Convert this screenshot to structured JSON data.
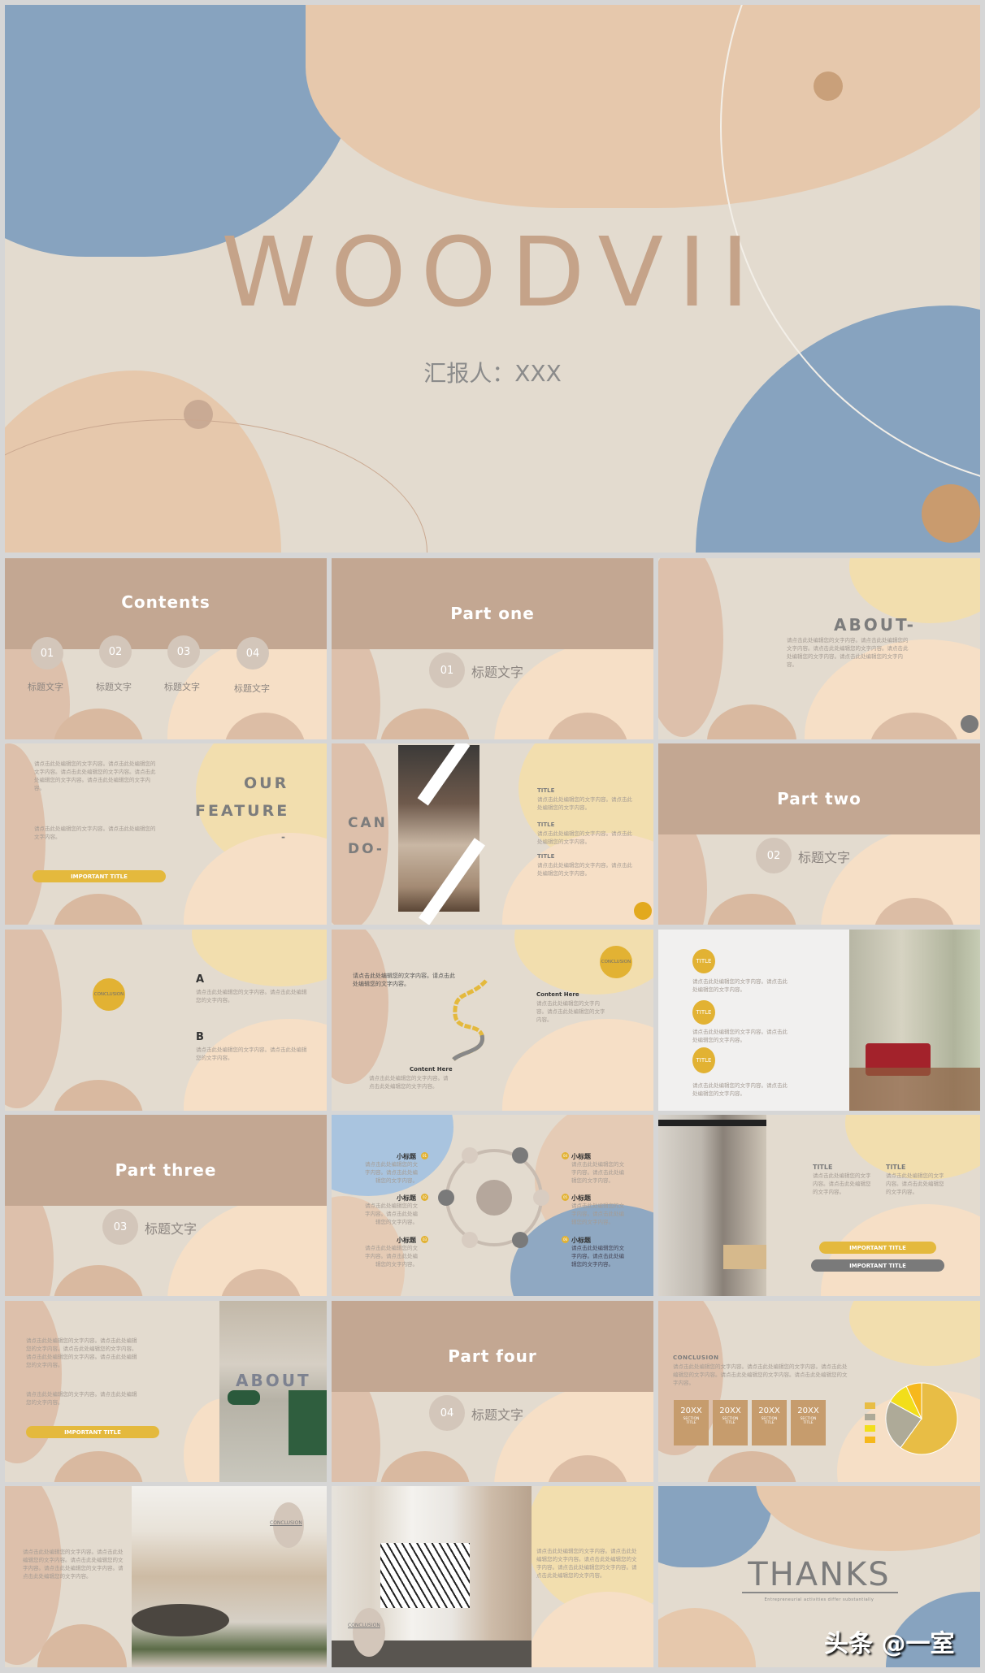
{
  "colors": {
    "bg": "#e3dbcf",
    "tan": "#c3a792",
    "peach": "#e8c9ad",
    "blue": "#87a3bf",
    "yellow": "#e2b233",
    "gray": "#7c7c7c"
  },
  "cover": {
    "title": "WOODVII",
    "reporter": "汇报人：XXX"
  },
  "placeholder_text": "请点击此处编辑您的文字内容。请点击此处编辑您的文字内容。",
  "placeholder_long": "请点击此处编辑您的文字内容。请点击此处编辑您的文字内容。请点击此处编辑您的文字内容。请点击此处编辑您的文字内容。请点击此处编辑您的文字内容。",
  "contents": {
    "title": "Contents",
    "items": [
      {
        "num": "01",
        "label": "标题文字"
      },
      {
        "num": "02",
        "label": "标题文字"
      },
      {
        "num": "03",
        "label": "标题文字"
      },
      {
        "num": "04",
        "label": "标题文字"
      }
    ]
  },
  "parts": [
    {
      "title": "Part one",
      "num": "01",
      "label": "标题文字"
    },
    {
      "title": "Part two",
      "num": "02",
      "label": "标题文字"
    },
    {
      "title": "Part three",
      "num": "03",
      "label": "标题文字"
    },
    {
      "title": "Part four",
      "num": "04",
      "label": "标题文字"
    }
  ],
  "about": {
    "title": "ABOUT-"
  },
  "feature": {
    "line1": "OUR",
    "line2": "FEATURE",
    "dash": "-",
    "button": "IMPORTANT TITLE"
  },
  "cando": {
    "line1": "CAN",
    "line2": "DO-",
    "items": [
      "TITLE",
      "TITLE",
      "TITLE"
    ]
  },
  "conclusion_ab": {
    "badge": "CONCLUSION",
    "a": "A",
    "b": "B"
  },
  "flow": {
    "badge": "CONCLUSION",
    "content1": "Content Here",
    "content2": "Content Here"
  },
  "titles3": {
    "items": [
      "TITLE",
      "TITLE",
      "TITLE"
    ]
  },
  "cycle": {
    "heading": "小标题",
    "nums": [
      "01",
      "02",
      "03",
      "04",
      "05",
      "06"
    ]
  },
  "interior": {
    "titles": [
      "TITLE",
      "TITLE"
    ],
    "button1": "IMPORTANT TITLE",
    "button2": "IMPORTANT TITLE"
  },
  "about2": {
    "overlay": "ABOUT",
    "button": "IMPORTANT TITLE"
  },
  "summary": {
    "heading": "CONCLUSION",
    "boxes": [
      {
        "year": "20XX",
        "label": "SECTION TITLE"
      },
      {
        "year": "20XX",
        "label": "SECTION TITLE"
      },
      {
        "year": "20XX",
        "label": "SECTION TITLE"
      },
      {
        "year": "20XX",
        "label": "SECTION TITLE"
      }
    ],
    "pie": [
      {
        "value": 60,
        "color": "#e8bd45"
      },
      {
        "value": 23,
        "color": "#aeaa98"
      },
      {
        "value": 10,
        "color": "#f2de1b"
      },
      {
        "value": 7,
        "color": "#f6b81c"
      }
    ]
  },
  "gallery": {
    "badge1": "CONCLUSION",
    "badge2": "CONCLUSION"
  },
  "thanks": {
    "title": "THANKS",
    "tagline": "Entrepreneurial  activities differ substantially"
  },
  "watermark": "头条 @一室"
}
